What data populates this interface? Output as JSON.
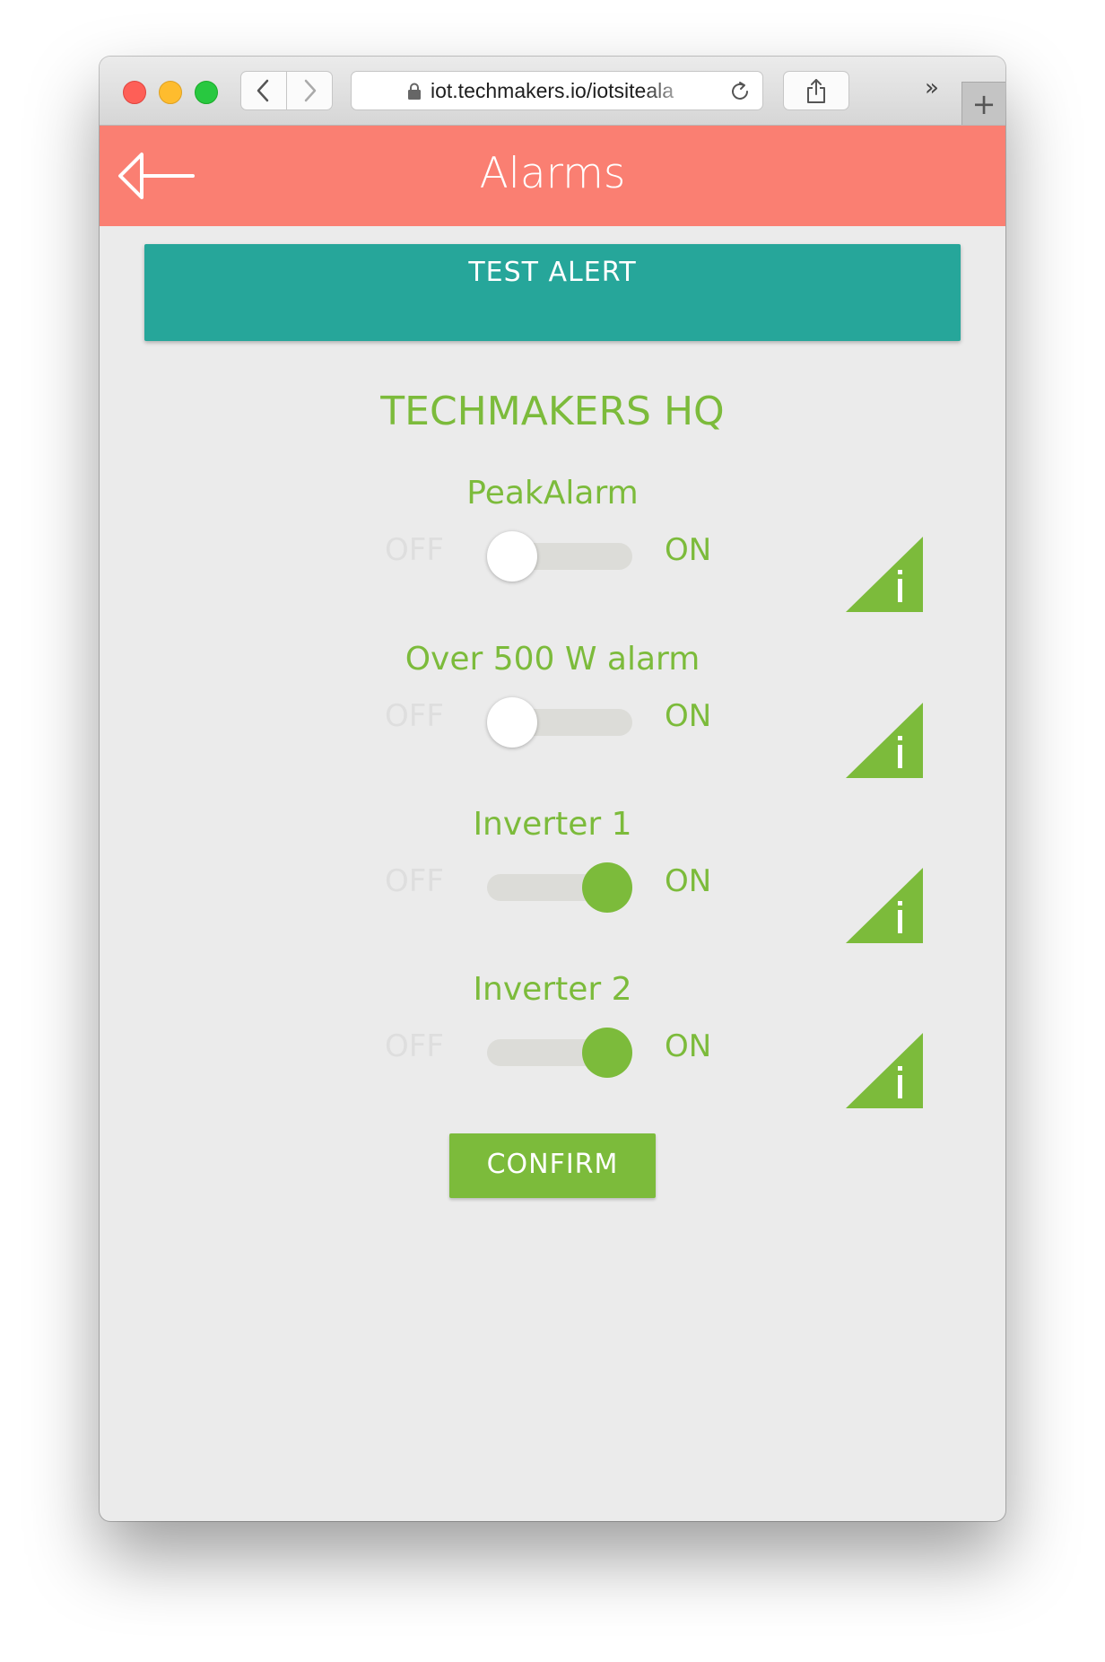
{
  "browser": {
    "url": "iot.techmakers.io/iotsiteala"
  },
  "header": {
    "title": "Alarms"
  },
  "test_alert": {
    "label": "TEST ALERT"
  },
  "site": {
    "title": "TECHMAKERS HQ"
  },
  "alarms": [
    {
      "name": "PeakAlarm",
      "off_label": "OFF",
      "on_label": "ON",
      "enabled": false
    },
    {
      "name": "Over 500 W alarm",
      "off_label": "OFF",
      "on_label": "ON",
      "enabled": false
    },
    {
      "name": "Inverter 1",
      "off_label": "OFF",
      "on_label": "ON",
      "enabled": true
    },
    {
      "name": "Inverter 2",
      "off_label": "OFF",
      "on_label": "ON",
      "enabled": true
    }
  ],
  "confirm": {
    "label": "CONFIRM"
  },
  "colors": {
    "header": "#fa7f72",
    "accent_teal": "#26a69a",
    "accent_green": "#7cbb3b",
    "background": "#ebebeb"
  },
  "icons": {
    "header_back": "back-arrow-icon",
    "alarm_info": "info-triangle-icon"
  }
}
